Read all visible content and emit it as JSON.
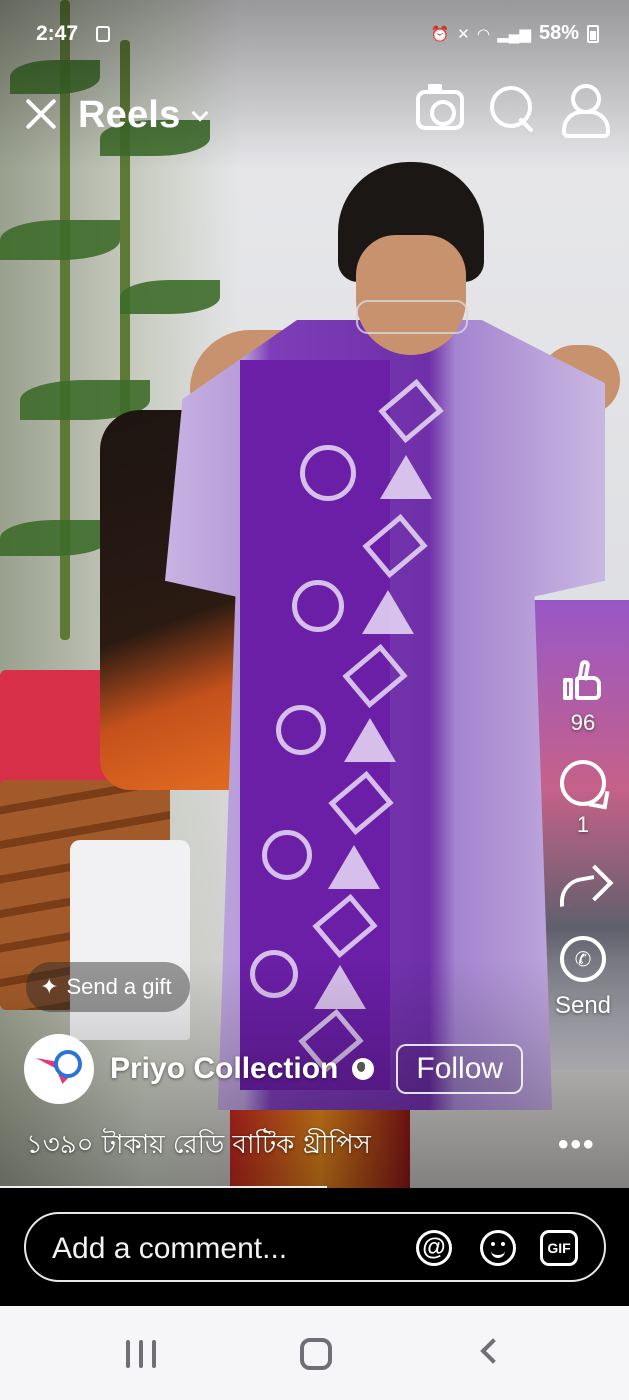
{
  "status_bar": {
    "time": "2:47",
    "battery": "58%"
  },
  "header": {
    "title": "Reels"
  },
  "actions": {
    "like_count": "96",
    "comment_count": "1",
    "send_label": "Send",
    "whatsapp_glyph": "✆"
  },
  "gift": {
    "label": "Send a gift"
  },
  "author": {
    "name": "Priyo Collection",
    "follow_label": "Follow"
  },
  "caption": "১৩৯০ টাকায় রেডি বাটিক থ্রীপিস",
  "more_glyph": "•••",
  "comment_bar": {
    "placeholder": "Add a comment...",
    "at_glyph": "@",
    "gif_label": "GIF"
  },
  "icons": [
    "close-icon",
    "chevron-down-icon",
    "camera-icon",
    "search-icon",
    "profile-icon",
    "like-icon",
    "comment-icon",
    "share-icon",
    "whatsapp-icon",
    "gift-icon",
    "globe-icon",
    "more-icon",
    "at-icon",
    "emoji-icon",
    "gif-icon"
  ],
  "video": {
    "progress_fraction": 0.52
  }
}
